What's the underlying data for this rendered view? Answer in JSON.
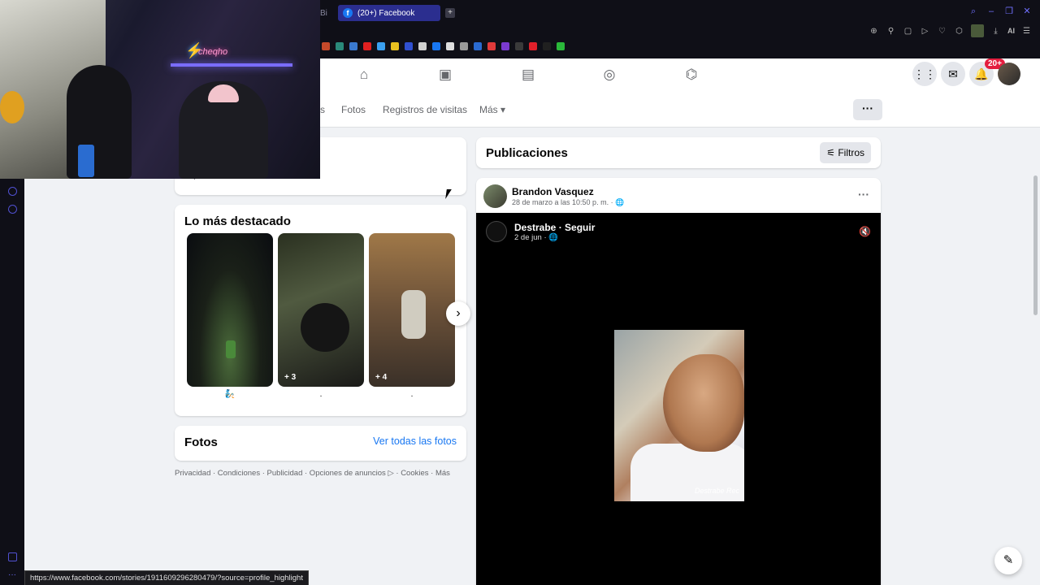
{
  "browser": {
    "tab_prev": "Bi",
    "tab_title": "(20+) Facebook",
    "new_tab": "+",
    "ai_label": "AI",
    "status_url": "https://www.facebook.com/stories/1911609296280479/?source=profile_highlight"
  },
  "bookmark_colors": [
    "#c44a2a",
    "#2a8a7a",
    "#3a7ad0",
    "#e02020",
    "#3aa0f0",
    "#e8c020",
    "#3050d0",
    "#d0d0d0",
    "#1877f2",
    "#ddd",
    "#9a9a9a",
    "#2a6ad0",
    "#e03a3a",
    "#7a3ad0",
    "#3a3a3a",
    "#e0202a",
    "#202020",
    "#2ab83a"
  ],
  "webcam": {
    "neon_text": "cheqho"
  },
  "nav": {
    "notification_count": "20+"
  },
  "profile_tabs": {
    "partial": "s",
    "photos": "Fotos",
    "visits": "Registros de visitas",
    "more": "Más",
    "menu_dots": "···"
  },
  "highlights": {
    "title": "Lo más destacado",
    "items": [
      {
        "count": "",
        "label": "🧞"
      },
      {
        "count": "+ 3",
        "label": "."
      },
      {
        "count": "+ 4",
        "label": "."
      }
    ]
  },
  "photos_card": {
    "title": "Fotos",
    "see_all": "Ver todas las fotos"
  },
  "footer": "Privacidad · Condiciones · Publicidad · Opciones de anuncios ▷ · Cookies · Más",
  "posts": {
    "title": "Publicaciones",
    "filters": "Filtros",
    "author": "Brandon Vasquez",
    "date": "28 de marzo a las 10:50 p. m. · 🌐",
    "menu": "···",
    "video": {
      "page_name": "Destrabe · Seguir",
      "date": "2 de jun · 🌐",
      "watermark": "Destrabe Rec"
    }
  },
  "colors": {
    "facebook_blue": "#1877f2",
    "badge_red": "#e41e3f",
    "tab_active": "#2b2e8f"
  }
}
